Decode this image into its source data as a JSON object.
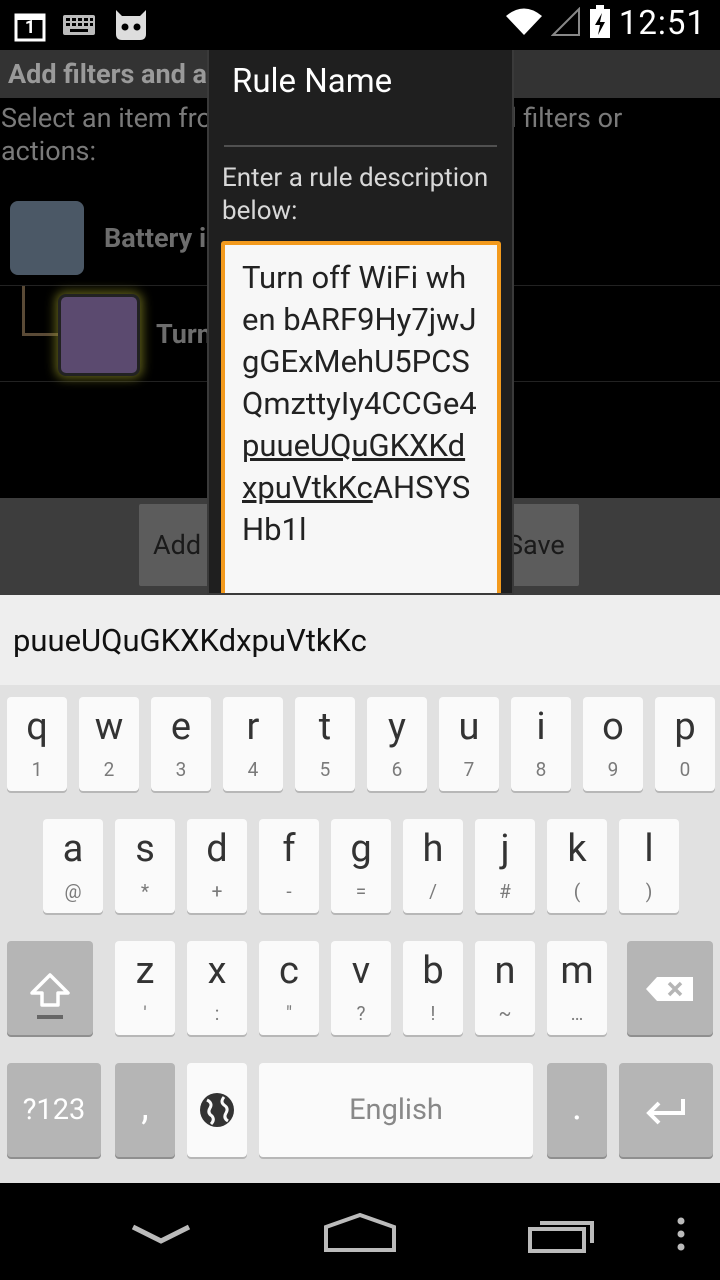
{
  "status_bar": {
    "time": "12:51",
    "left_icons": [
      "notification-1-icon",
      "keyboard-icon",
      "cyanogenmod-icon"
    ],
    "right_icons": [
      "wifi-icon",
      "signal-icon",
      "battery-charging-icon"
    ],
    "notification_digit": "1"
  },
  "background": {
    "title": "Add filters and actions to your rule",
    "subtitle": "Select an item from the list below, then add filters or actions:",
    "row1_label": "Battery is low",
    "row2_label": "Turn off WiFi",
    "add_button": "Add filter/action",
    "save_button": "Save"
  },
  "dialog": {
    "title": "Rule Name",
    "message": "Enter a rule description below:",
    "field_prefix": "Turn off WiFi when bARF9Hy7jwJgGExMehU5PCSQmzttyIy4CCGe4",
    "field_underlined": "puueUQuGKXKdxpuVtkKc",
    "field_suffix": "AHSYSHb1l"
  },
  "suggestion": {
    "word": "puueUQuGKXKdxpuVtkKc"
  },
  "keyboard": {
    "row1": [
      {
        "k": "q",
        "h": "1"
      },
      {
        "k": "w",
        "h": "2"
      },
      {
        "k": "e",
        "h": "3"
      },
      {
        "k": "r",
        "h": "4"
      },
      {
        "k": "t",
        "h": "5"
      },
      {
        "k": "y",
        "h": "6"
      },
      {
        "k": "u",
        "h": "7"
      },
      {
        "k": "i",
        "h": "8"
      },
      {
        "k": "o",
        "h": "9"
      },
      {
        "k": "p",
        "h": "0"
      }
    ],
    "row2": [
      {
        "k": "a",
        "h": "@"
      },
      {
        "k": "s",
        "h": "*"
      },
      {
        "k": "d",
        "h": "+"
      },
      {
        "k": "f",
        "h": "-"
      },
      {
        "k": "g",
        "h": "="
      },
      {
        "k": "h",
        "h": "/"
      },
      {
        "k": "j",
        "h": "#"
      },
      {
        "k": "k",
        "h": "("
      },
      {
        "k": "l",
        "h": ")"
      }
    ],
    "row3": [
      {
        "k": "z",
        "h": "'"
      },
      {
        "k": "x",
        "h": ":"
      },
      {
        "k": "c",
        "h": "\""
      },
      {
        "k": "v",
        "h": "?"
      },
      {
        "k": "b",
        "h": "!"
      },
      {
        "k": "n",
        "h": "~"
      },
      {
        "k": "m",
        "h": "…"
      }
    ],
    "symbols_key": "?123",
    "comma_key": ",",
    "space_label": "English",
    "period_key": ".",
    "special_icons": [
      "shift-icon",
      "backspace-icon",
      "globe-icon",
      "enter-icon"
    ]
  },
  "nav_bar": {
    "icons": [
      "back-icon",
      "home-icon",
      "recents-icon",
      "overflow-menu-icon"
    ]
  }
}
